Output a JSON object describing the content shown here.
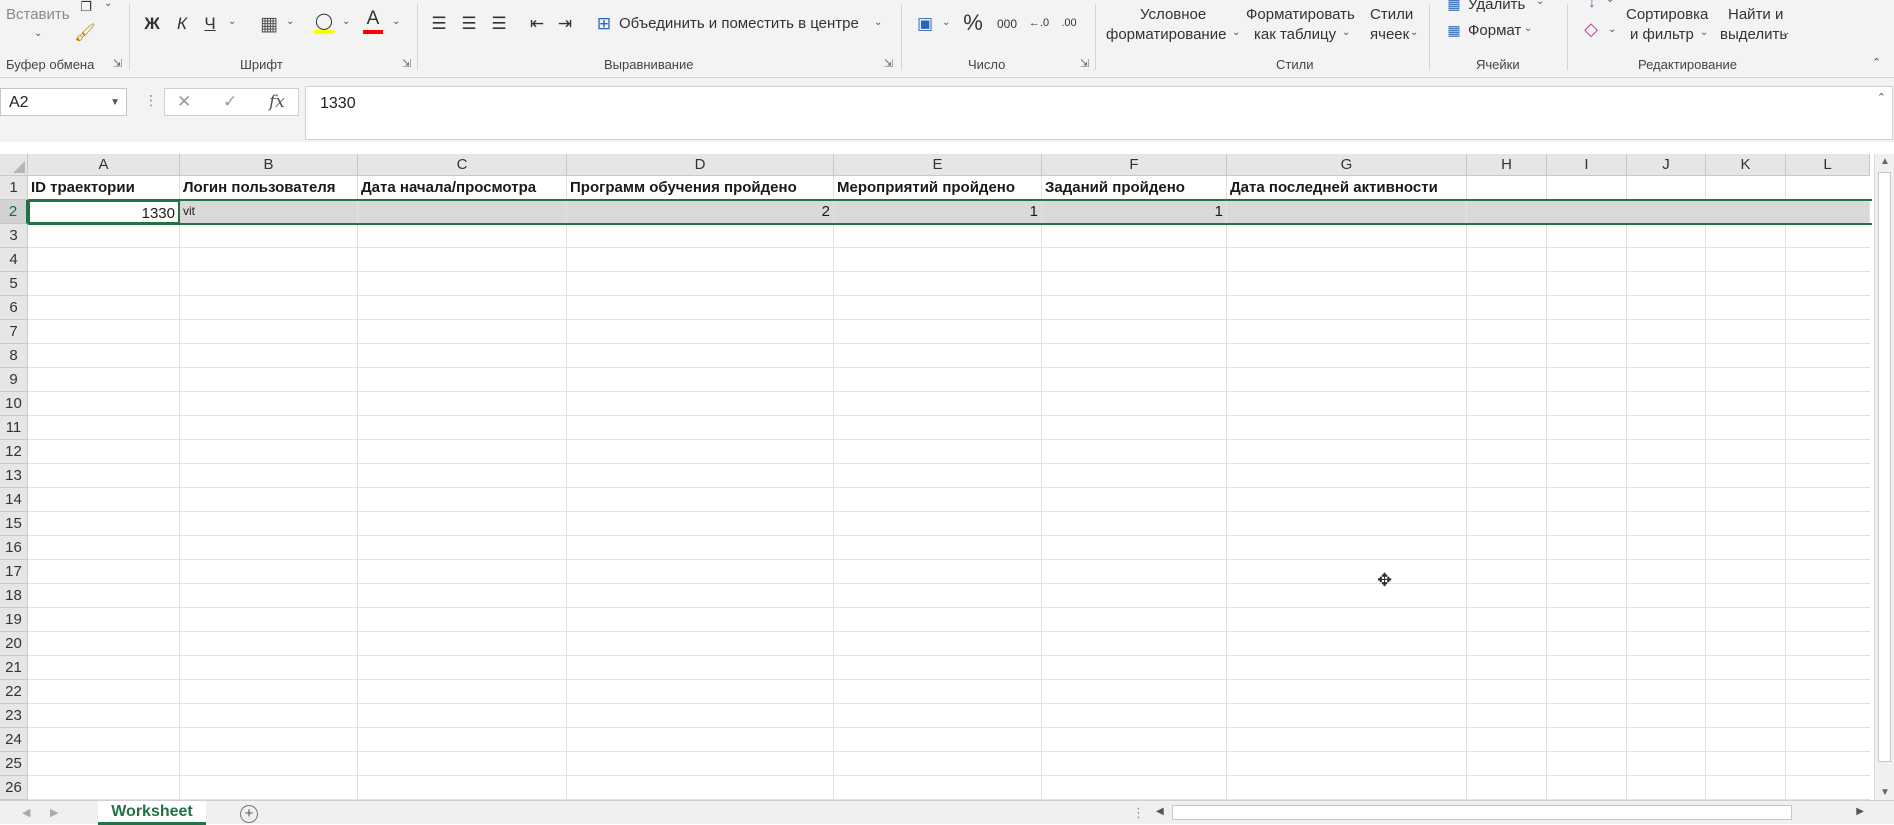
{
  "ribbon": {
    "clipboard": {
      "paste_label": "Вставить",
      "group_label": "Буфер обмена"
    },
    "font": {
      "bold": "Ж",
      "italic": "К",
      "underline": "Ч",
      "group_label": "Шрифт",
      "highlight_color": "#ffff00",
      "font_color": "#ff0000"
    },
    "alignment": {
      "merge_label": "Объединить и поместить в центре",
      "group_label": "Выравнивание"
    },
    "number": {
      "percent": "%",
      "thousands": "000",
      "group_label": "Число"
    },
    "styles": {
      "conditional_line1": "Условное",
      "conditional_line2": "форматирование",
      "table_line1": "Форматировать",
      "table_line2": "как таблицу",
      "cell_line1": "Стили",
      "cell_line2": "ячеек",
      "group_label": "Стили"
    },
    "cells": {
      "delete_label": "Удалить",
      "format_label": "Формат",
      "group_label": "Ячейки"
    },
    "editing": {
      "sort_line1": "Сортировка",
      "sort_line2": "и фильтр",
      "find_line1": "Найти и",
      "find_line2": "выделить",
      "group_label": "Редактирование"
    }
  },
  "formula_bar": {
    "name_box": "A2",
    "fx": "fx",
    "content": "1330"
  },
  "grid": {
    "columns": [
      "A",
      "B",
      "C",
      "D",
      "E",
      "F",
      "G",
      "H",
      "I",
      "J",
      "K",
      "L"
    ],
    "rows": [
      "1",
      "2",
      "3",
      "4",
      "5",
      "6",
      "7",
      "8",
      "9",
      "10",
      "11",
      "12",
      "13",
      "14",
      "15",
      "16",
      "17",
      "18",
      "19",
      "20",
      "21",
      "22",
      "23",
      "24",
      "25",
      "26"
    ],
    "headers": [
      "ID траектории",
      "Логин пользователя",
      "Дата начала/просмотра",
      "Программ обучения пройдено",
      "Мероприятий пройдено",
      "Заданий пройдено",
      "Дата последней активности"
    ],
    "row2": [
      "1330",
      "vit",
      "",
      "2",
      "1",
      "1",
      ""
    ]
  },
  "sheets": {
    "active": "Worksheet"
  },
  "colors": {
    "accent": "#217346",
    "selected_row": "#d9d9d9"
  }
}
